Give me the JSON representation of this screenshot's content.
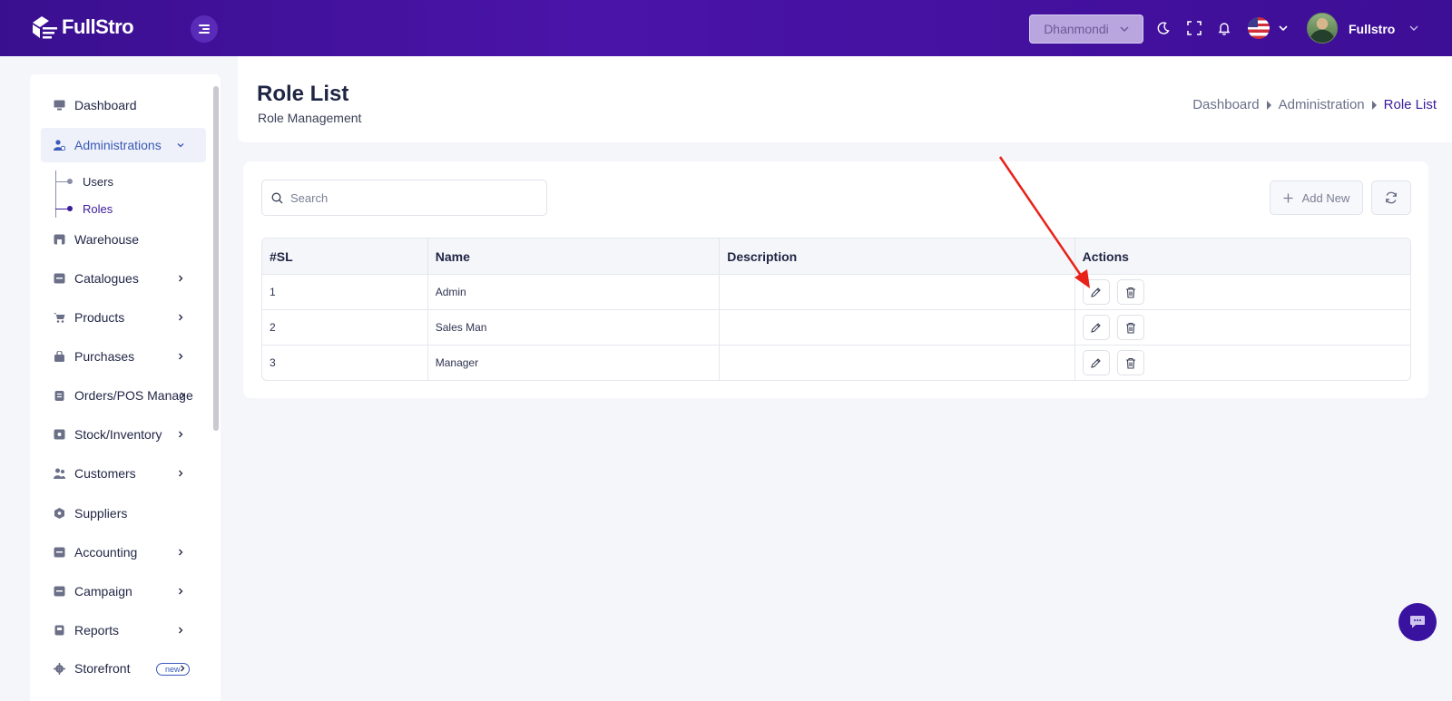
{
  "app": {
    "brand": "FullStro",
    "branch": "Dhanmondi",
    "username": "Fullstro"
  },
  "sidebar": {
    "items": [
      {
        "label": "Dashboard",
        "icon": "monitor-icon"
      },
      {
        "label": "Administrations",
        "icon": "user-cog-icon"
      },
      {
        "label": "Warehouse",
        "icon": "warehouse-icon"
      },
      {
        "label": "Catalogues",
        "icon": "box-icon"
      },
      {
        "label": "Products",
        "icon": "cart-icon"
      },
      {
        "label": "Purchases",
        "icon": "bag-icon"
      },
      {
        "label": "Orders/POS Manage",
        "icon": "clipboard-icon"
      },
      {
        "label": "Stock/Inventory",
        "icon": "stock-icon"
      },
      {
        "label": "Customers",
        "icon": "users-icon"
      },
      {
        "label": "Suppliers",
        "icon": "supplier-icon"
      },
      {
        "label": "Accounting",
        "icon": "ledger-icon"
      },
      {
        "label": "Campaign",
        "icon": "campaign-icon"
      },
      {
        "label": "Reports",
        "icon": "report-icon"
      },
      {
        "label": "Storefront",
        "icon": "gear-icon",
        "badge": "new"
      }
    ],
    "sub_items": [
      {
        "label": "Users"
      },
      {
        "label": "Roles"
      }
    ]
  },
  "header": {
    "title": "Role List",
    "subtitle": "Role Management",
    "breadcrumb": [
      "Dashboard",
      "Administration",
      "Role List"
    ]
  },
  "toolbar": {
    "search_placeholder": "Search",
    "add_label": "Add New"
  },
  "table": {
    "columns": [
      "#SL",
      "Name",
      "Description",
      "Actions"
    ],
    "rows": [
      {
        "sl": "1",
        "name": "Admin",
        "description": ""
      },
      {
        "sl": "2",
        "name": "Sales Man",
        "description": ""
      },
      {
        "sl": "3",
        "name": "Manager",
        "description": ""
      }
    ]
  },
  "colors": {
    "topbar": "#3d0e96",
    "accent": "#3a1c9a",
    "annotation_arrow": "#e8221b"
  }
}
